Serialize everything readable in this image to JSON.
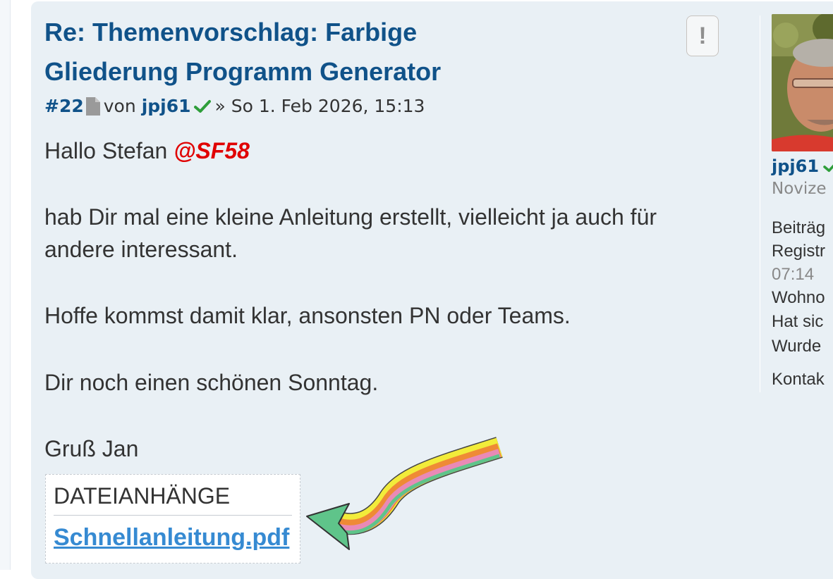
{
  "post": {
    "title": "Re: Themenvorschlag: Farbige Gliederung Programm Generator",
    "report_label": "!",
    "post_number": "#22",
    "by_text": "von",
    "author": "jpj61",
    "date_text": "» So 1. Feb 2026, 15:13",
    "greeting": "Hallo Stefan ",
    "mention": "@SF58",
    "paragraphs": [
      "hab Dir mal eine kleine Anleitung erstellt, vielleicht ja auch für andere interessant.",
      "Hoffe kommst damit klar, ansonsten PN oder Teams.",
      "Dir noch einen schönen Sonntag.",
      "Gruß Jan"
    ],
    "attachments": {
      "heading": "DATEIANHÄNGE",
      "file_name": "Schnellanleitung.pdf"
    }
  },
  "profile": {
    "username": "jpj61",
    "rank": "Novize",
    "lines": [
      "Beiträg",
      "Registr",
      "07:14",
      "Wohno",
      "Hat sic",
      "Wurde",
      "Kontak"
    ]
  },
  "colors": {
    "title_blue": "#105289",
    "link_blue": "#368ad2",
    "mention_red": "#e00000",
    "post_bg": "#e9f0f5",
    "check_green": "#2e9e3a"
  },
  "icons": {
    "post_icon": "document-icon",
    "verified": "checkmark-icon",
    "report": "exclamation-icon",
    "annotation": "rainbow-arrow"
  }
}
